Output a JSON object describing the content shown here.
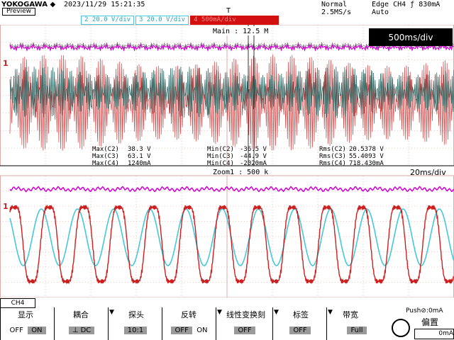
{
  "header": {
    "brand": "YOKOGAWA ◆",
    "mode_label": "Preview",
    "datetime": "2023/11/29  15:21:35",
    "acq_mode": "Normal",
    "sample_rate": "2.5MS/s",
    "trigger_type": "Edge CH4 ƒ 830mA",
    "trigger_mode": "Auto",
    "trigger_marker": "T"
  },
  "channels": [
    {
      "id": "2",
      "scale": "20.0 V/div"
    },
    {
      "id": "3",
      "scale": "20.0 V/div"
    },
    {
      "id": "4",
      "scale": "500mA/div"
    }
  ],
  "main_window": {
    "label": "Main : 12.5 M",
    "timebase": "500ms/div"
  },
  "measurements": [
    [
      "Max(C2)",
      "38.3 V",
      "Min(C2)",
      "-36.5 V",
      "Rms(C2)",
      "20.5378 V"
    ],
    [
      "Max(C3)",
      "63.1 V",
      "Min(C3)",
      "-44.9 V",
      "Rms(C3)",
      "55.4093 V"
    ],
    [
      "Max(C4)",
      "1240mA",
      "Min(C4)",
      "-2020mA",
      "Rms(C4)",
      "718.430mA"
    ]
  ],
  "zoom_window": {
    "label": "Zoom1 : 500 k",
    "timebase": "20ms/div"
  },
  "markers": {
    "ch1_marker": "1",
    "ch4_marker": "1"
  },
  "softkeys": {
    "channel": "CH4",
    "items": [
      {
        "title": "显示",
        "left": "OFF",
        "right": "ON"
      },
      {
        "title": "耦合",
        "value": "⊥ DC"
      },
      {
        "title": "探头",
        "value": "10:1"
      },
      {
        "title": "反转",
        "left": "OFF",
        "right": "ON"
      },
      {
        "title": "线性变换刻",
        "value": "OFF"
      },
      {
        "title": "标签",
        "value": "OFF"
      },
      {
        "title": "带宽",
        "value": "Full"
      }
    ],
    "push": {
      "label": "Push⊘:0mA",
      "title": "偏置",
      "value": "0mA"
    }
  },
  "colors": {
    "ch2": "#45c8d8",
    "ch3": "#cc2020",
    "ch4": "#d000d0",
    "grid": "#d49a9a",
    "background": "#ffffff",
    "main_dark": "#1f5a55"
  }
}
